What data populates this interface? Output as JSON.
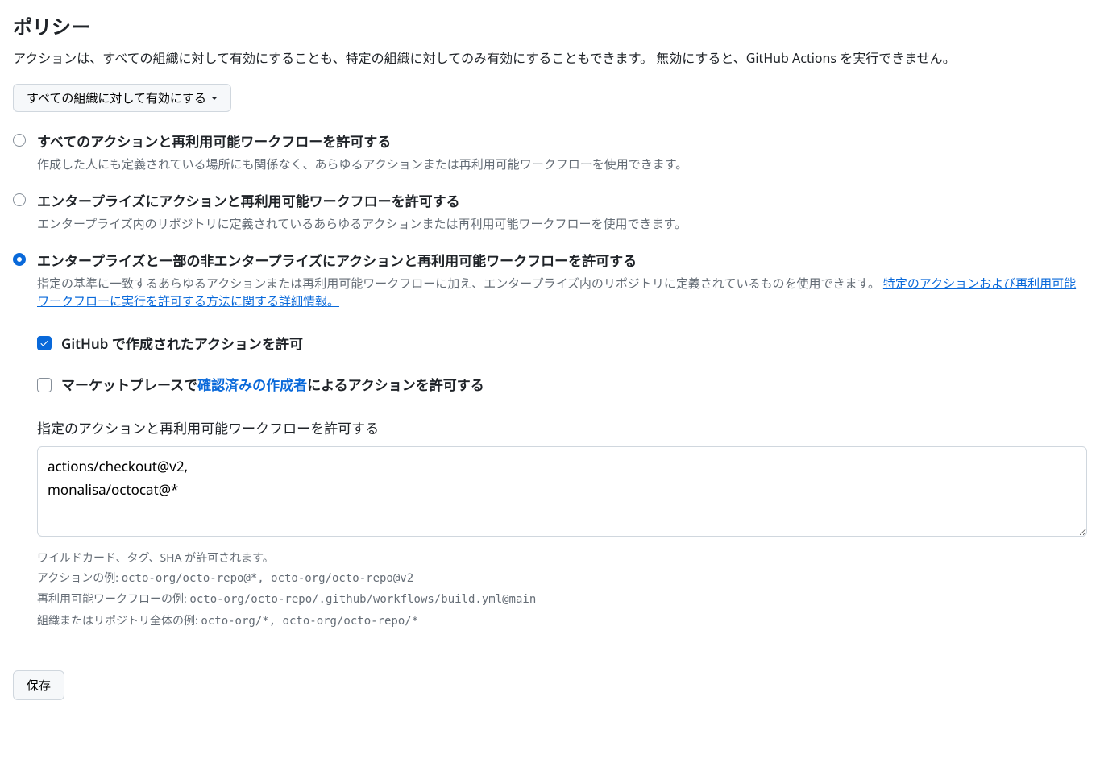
{
  "heading": "ポリシー",
  "description": "アクションは、すべての組織に対して有効にすることも、特定の組織に対してのみ有効にすることもできます。 無効にすると、GitHub Actions を実行できません。",
  "dropdown": {
    "label": "すべての組織に対して有効にする"
  },
  "options": [
    {
      "title": "すべてのアクションと再利用可能ワークフローを許可する",
      "desc": "作成した人にも定義されている場所にも関係なく、あらゆるアクションまたは再利用可能ワークフローを使用できます。",
      "selected": false
    },
    {
      "title": "エンタープライズにアクションと再利用可能ワークフローを許可する",
      "desc": "エンタープライズ内のリポジトリに定義されているあらゆるアクションまたは再利用可能ワークフローを使用できます。",
      "selected": false
    },
    {
      "title": "エンタープライズと一部の非エンタープライズにアクションと再利用可能ワークフローを許可する",
      "desc_prefix": "指定の基準に一致するあらゆるアクションまたは再利用可能ワークフローに加え、エンタープライズ内のリポジトリに定義されているものを使用できます。 ",
      "desc_link": "特定のアクションおよび再利用可能ワークフローに実行を許可する方法に関する詳細情報。",
      "selected": true
    }
  ],
  "checkboxes": {
    "github_created": {
      "label": "GitHub で作成されたアクションを許可",
      "checked": true
    },
    "marketplace": {
      "prefix": "マーケットプレースで",
      "link": "確認済みの作成者",
      "suffix": "によるアクションを許可する",
      "checked": false
    }
  },
  "specified": {
    "label": "指定のアクションと再利用可能ワークフローを許可する",
    "value": "actions/checkout@v2,\nmonalisa/octocat@*"
  },
  "help": {
    "line1": "ワイルドカード、タグ、SHA が許可されます。",
    "line2_prefix": "アクションの例: ",
    "line2_code": "octo-org/octo-repo@*, octo-org/octo-repo@v2",
    "line3_prefix": "再利用可能ワークフローの例: ",
    "line3_code": "octo-org/octo-repo/.github/workflows/build.yml@main",
    "line4_prefix": "組織またはリポジトリ全体の例: ",
    "line4_code": "octo-org/*, octo-org/octo-repo/*"
  },
  "save_button": "保存"
}
